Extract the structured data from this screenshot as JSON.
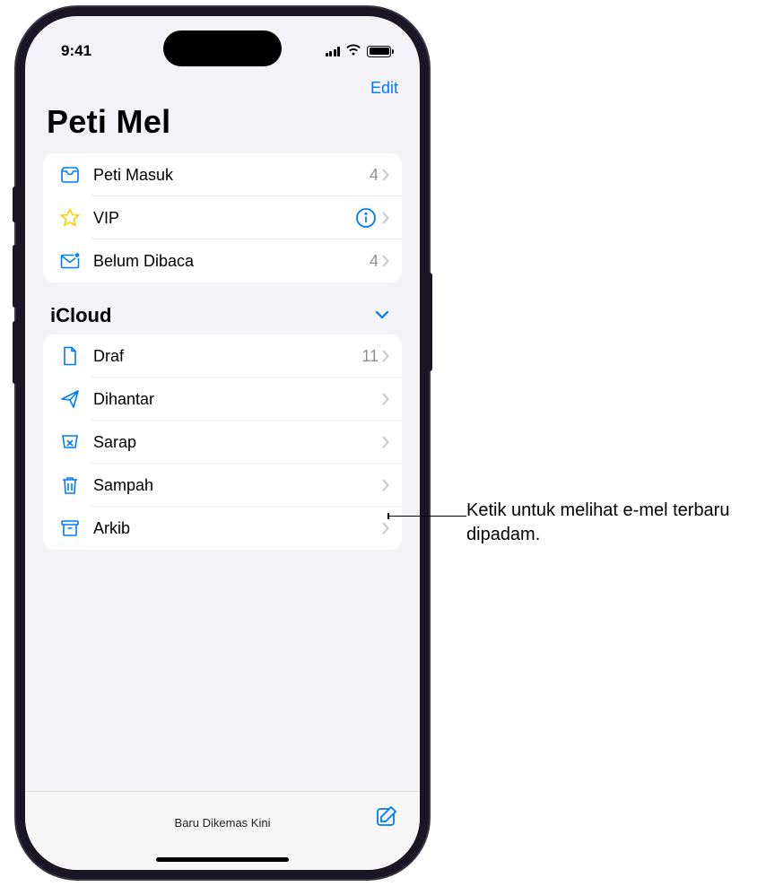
{
  "status": {
    "time": "9:41"
  },
  "nav": {
    "edit_label": "Edit"
  },
  "title": "Peti Mel",
  "favorites": [
    {
      "icon": "inbox",
      "label": "Peti Masuk",
      "count": "4",
      "info": false
    },
    {
      "icon": "star",
      "label": "VIP",
      "count": "",
      "info": true
    },
    {
      "icon": "unread",
      "label": "Belum Dibaca",
      "count": "4",
      "info": false
    }
  ],
  "section": {
    "title": "iCloud"
  },
  "icloud": [
    {
      "icon": "draft",
      "label": "Draf",
      "count": "11"
    },
    {
      "icon": "sent",
      "label": "Dihantar",
      "count": ""
    },
    {
      "icon": "junk",
      "label": "Sarap",
      "count": ""
    },
    {
      "icon": "trash",
      "label": "Sampah",
      "count": ""
    },
    {
      "icon": "archive",
      "label": "Arkib",
      "count": ""
    }
  ],
  "bottom": {
    "status": "Baru Dikemas Kini"
  },
  "callout": {
    "text": "Ketik untuk melihat e-mel terbaru dipadam."
  }
}
